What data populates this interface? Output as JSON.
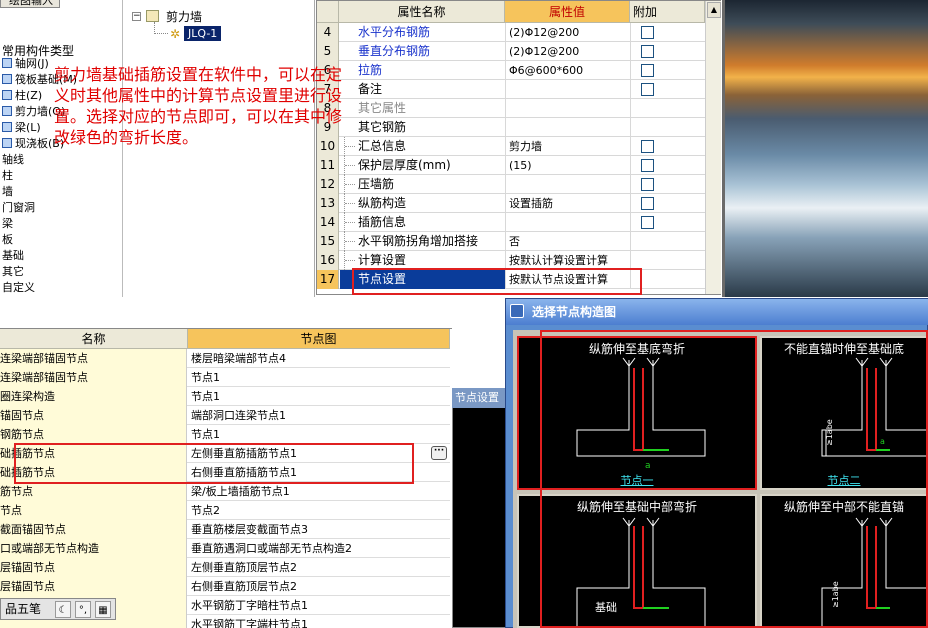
{
  "left_panel": {
    "top_button": "绘图输入",
    "category_title": "常用构件类型",
    "items": [
      "轴网(J)",
      "筏板基础(M)",
      "柱(Z)",
      "剪力墙(Q)",
      "梁(L)",
      "现浇板(B)",
      "轴线",
      "柱",
      "墙",
      "门窗洞",
      "梁",
      "板",
      "基础",
      "其它",
      "自定义"
    ]
  },
  "component_tree": {
    "root": "剪力墙",
    "child": "JLQ-1"
  },
  "property_grid": {
    "headers": {
      "name": "属性名称",
      "value": "属性值",
      "add": "附加"
    },
    "rows": [
      {
        "num": "4",
        "name": "水平分布钢筋",
        "value": "(2)Φ12@200",
        "style": "blue",
        "check": true
      },
      {
        "num": "5",
        "name": "垂直分布钢筋",
        "value": "(2)Φ12@200",
        "style": "blue",
        "check": true
      },
      {
        "num": "6",
        "name": "拉筋",
        "value": "Φ6@600*600",
        "style": "blue",
        "check": true
      },
      {
        "num": "7",
        "name": "备注",
        "value": "",
        "style": "",
        "check": true
      },
      {
        "num": "8",
        "name": "其它属性",
        "value": "",
        "style": "gray",
        "check": false
      },
      {
        "num": "9",
        "name": "其它钢筋",
        "value": "",
        "style": "",
        "check": false
      },
      {
        "num": "10",
        "name": "汇总信息",
        "value": "剪力墙",
        "style": "",
        "check": true
      },
      {
        "num": "11",
        "name": "保护层厚度(mm)",
        "value": "(15)",
        "style": "",
        "check": true
      },
      {
        "num": "12",
        "name": "压墙筋",
        "value": "",
        "style": "",
        "check": true
      },
      {
        "num": "13",
        "name": "纵筋构造",
        "value": "设置插筋",
        "style": "",
        "check": true
      },
      {
        "num": "14",
        "name": "插筋信息",
        "value": "",
        "style": "",
        "check": true
      },
      {
        "num": "15",
        "name": "水平钢筋拐角增加搭接",
        "value": "否",
        "style": "",
        "check": false
      },
      {
        "num": "16",
        "name": "计算设置",
        "value": "按默认计算设置计算",
        "style": "",
        "check": false
      },
      {
        "num": "17",
        "name": "节点设置",
        "value": "按默认节点设置计算",
        "style": "selected",
        "check": false
      }
    ]
  },
  "annotation_note": "剪力墙基础插筋设置在软件中，可以在定义时其他属性中的计算节点设置里进行设置。选择对应的节点即可，可以在其中修改绿色的弯折长度。",
  "node_table": {
    "headers": {
      "name": "名称",
      "value": "节点图"
    },
    "rows": [
      {
        "name": "连梁端部锚固节点",
        "value": "楼层暗梁端部节点4"
      },
      {
        "name": "连梁端部锚固节点",
        "value": "节点1"
      },
      {
        "name": "圈连梁构造",
        "value": "节点1"
      },
      {
        "name": "锚固节点",
        "value": "端部洞口连梁节点1"
      },
      {
        "name": "钢筋节点",
        "value": "节点1"
      },
      {
        "name": "础插筋节点",
        "value": "左侧垂直筋插筋节点1"
      },
      {
        "name": "础插筋节点",
        "value": "右侧垂直筋插筋节点1"
      },
      {
        "name": "筋节点",
        "value": "梁/板上墙插筋节点1"
      },
      {
        "name": "节点",
        "value": "节点2"
      },
      {
        "name": "截面锚固节点",
        "value": "垂直筋楼层变截面节点3"
      },
      {
        "name": "口或端部无节点构造",
        "value": "垂直筋遇洞口或端部无节点构造2"
      },
      {
        "name": "层锚固节点",
        "value": "左侧垂直筋顶层节点2"
      },
      {
        "name": "层锚固节点",
        "value": "右侧垂直筋顶层节点2"
      },
      {
        "name": "",
        "value": "水平钢筋丁字暗柱节点1"
      },
      {
        "name": "",
        "value": "水平钢筋丁字端柱节点1"
      }
    ],
    "dots_button": "···"
  },
  "background_dialog_title": "节点设置",
  "ime_bar": {
    "label": "品五笔"
  },
  "dialog": {
    "title": "选择节点构造图",
    "cards": [
      {
        "title": "纵筋伸至基底弯折",
        "node": "节点一",
        "extra": "a"
      },
      {
        "title": "不能直锚时伸至基础底",
        "node": "节点二",
        "extra": "a"
      },
      {
        "title": "纵筋伸至基础中部弯折",
        "node": "",
        "extra": "基础"
      },
      {
        "title": "纵筋伸至中部不能直锚",
        "node": "",
        "extra": ""
      }
    ]
  },
  "colors": {
    "selection": "#0a3c9a",
    "header_value": "#f6c45c",
    "highlight": "#e02020",
    "node_text": "#3fe4f0"
  }
}
